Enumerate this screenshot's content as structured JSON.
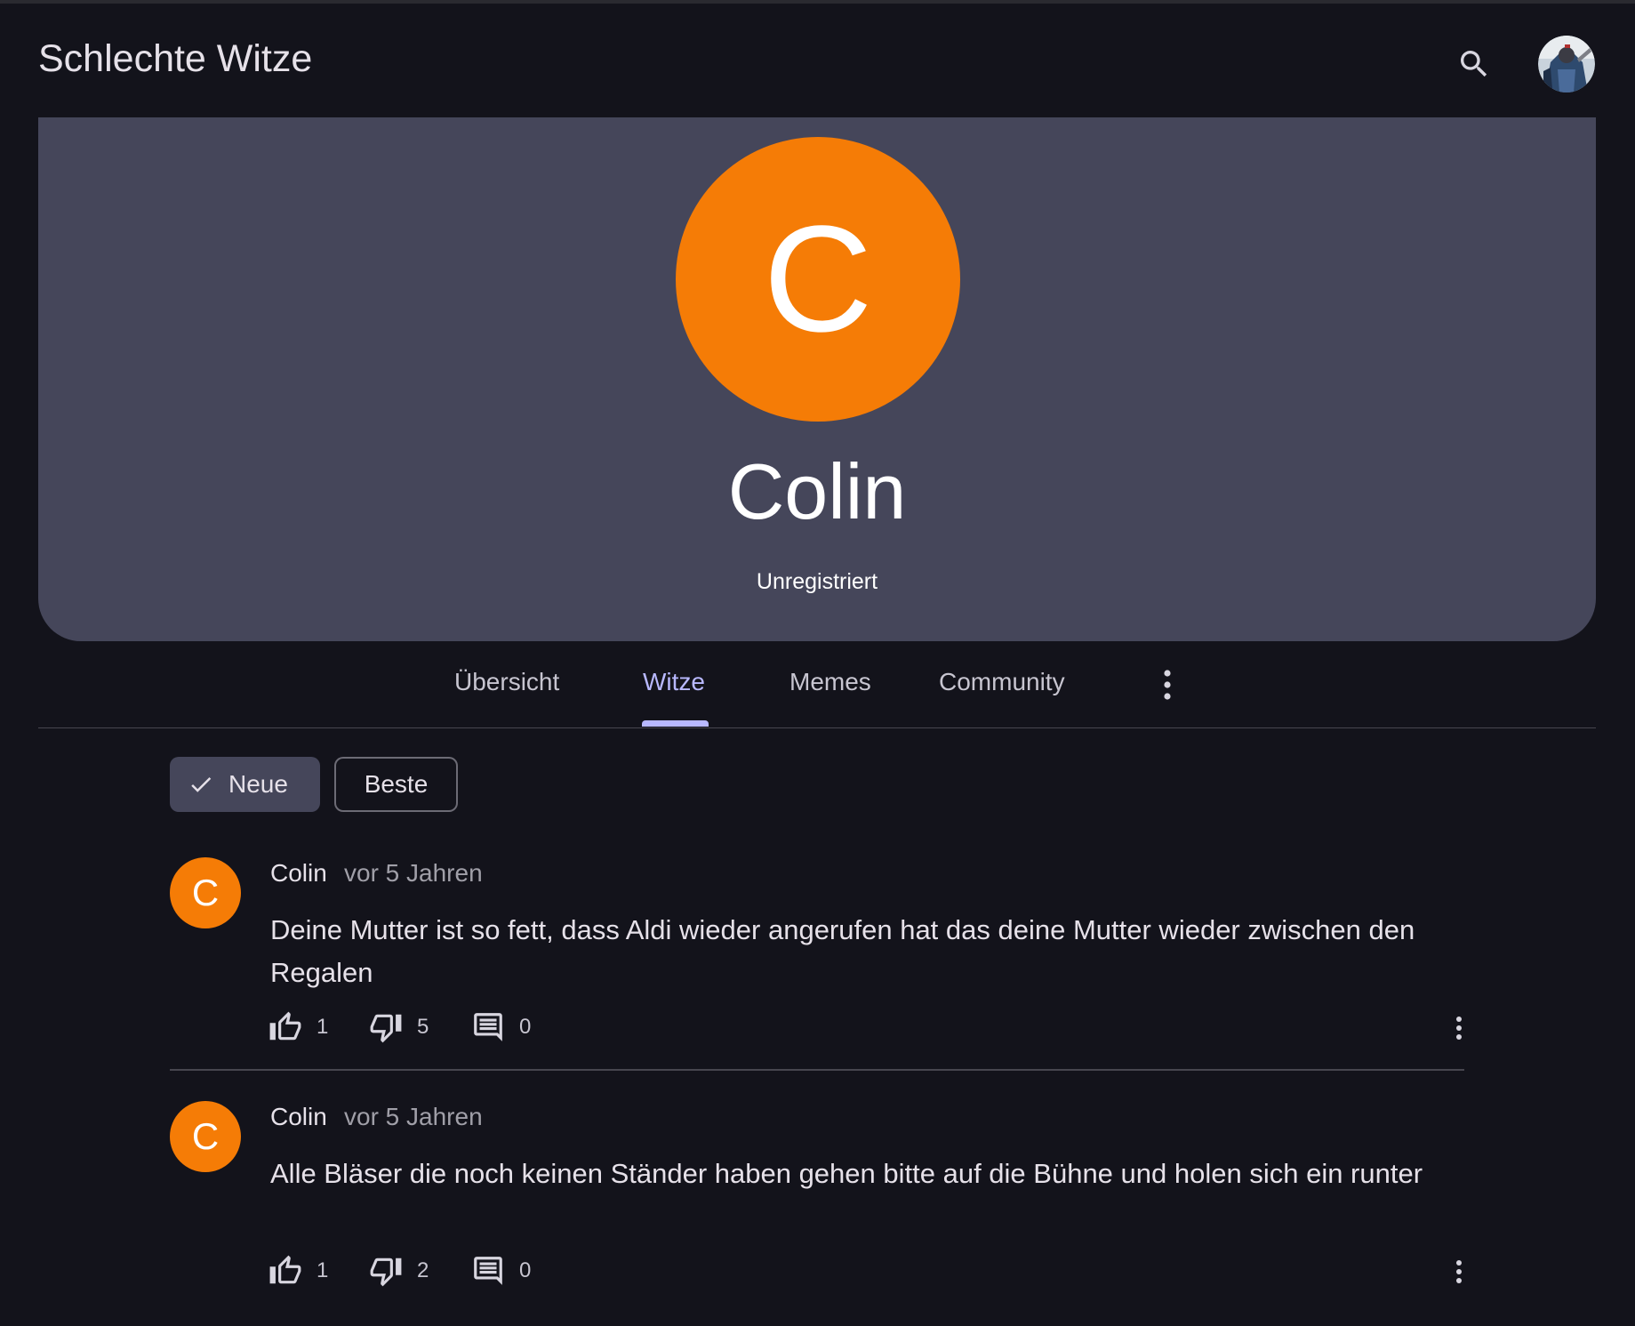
{
  "app": {
    "title": "Schlechte Witze",
    "icons": {
      "search": "search-icon",
      "account": "user-avatar"
    }
  },
  "profile": {
    "avatar_letter": "C",
    "name": "Colin",
    "status": "Unregistriert",
    "avatar_color": "#f57c06"
  },
  "tabs": [
    {
      "label": "Übersicht",
      "active": false
    },
    {
      "label": "Witze",
      "active": true
    },
    {
      "label": "Memes",
      "active": false
    },
    {
      "label": "Community",
      "active": false
    }
  ],
  "filters": {
    "new_label": "Neue",
    "best_label": "Beste",
    "selected": "Neue"
  },
  "posts": [
    {
      "avatar_letter": "C",
      "author": "Colin",
      "time": "vor 5 Jahren",
      "text": "Deine Mutter ist so fett, dass Aldi wieder angerufen hat das deine Mutter wieder zwischen den Regalen",
      "likes": "1",
      "dislikes": "5",
      "comments": "0"
    },
    {
      "avatar_letter": "C",
      "author": "Colin",
      "time": "vor 5 Jahren",
      "text": "Alle Bläser die noch keinen Ständer haben gehen bitte auf die Bühne und holen sich ein runter",
      "likes": "1",
      "dislikes": "2",
      "comments": "0"
    }
  ],
  "colors": {
    "background": "#13131b",
    "hero": "#45465a",
    "accent": "#b8b8ff",
    "avatar": "#f57c06"
  }
}
